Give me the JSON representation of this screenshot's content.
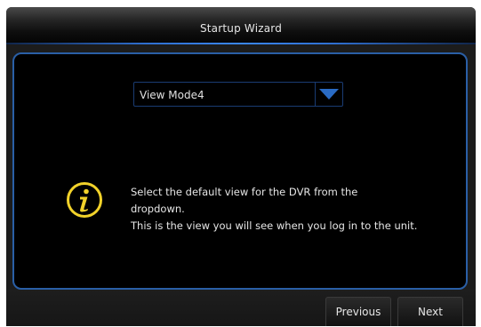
{
  "window": {
    "title": "Startup Wizard"
  },
  "dropdown": {
    "selected": "View Mode4",
    "arrow_icon": "triangle-down-icon"
  },
  "info": {
    "icon": "info-icon",
    "lines": [
      "Select the default view for the DVR from the",
      "dropdown.",
      "This is the view you will see when you log in to the unit."
    ]
  },
  "buttons": {
    "previous": "Previous",
    "next": "Next"
  },
  "colors": {
    "accent_blue": "#2a5fa6",
    "arrow_blue": "#2a6bc4",
    "info_yellow": "#f2d22a"
  }
}
